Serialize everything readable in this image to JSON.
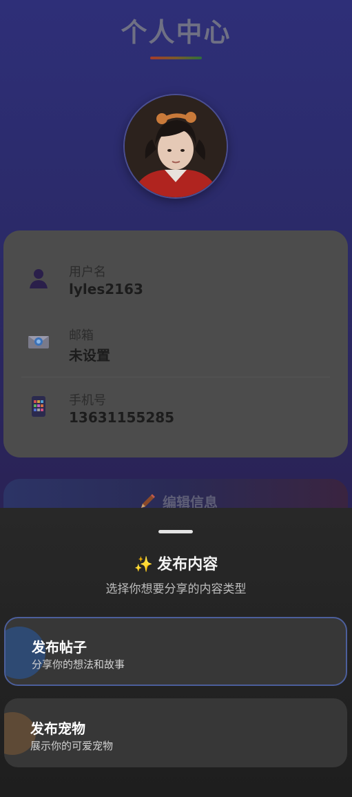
{
  "page": {
    "title": "个人中心",
    "colors": {
      "background": "#2b2a68",
      "card": "#4c4c4c",
      "accent_underline": [
        "#a63c2a",
        "#2f6f3a"
      ]
    }
  },
  "profile": {
    "avatar": "avatar-photo",
    "fields": [
      {
        "icon": "user-icon",
        "label": "用户名",
        "value": "lyles2163"
      },
      {
        "icon": "mail-icon",
        "label": "邮箱",
        "value": "未设置"
      },
      {
        "icon": "phone-icon",
        "label": "手机号",
        "value": "13631155285"
      }
    ],
    "edit_button": {
      "icon": "pencil-icon",
      "label": "编辑信息"
    }
  },
  "sheet": {
    "title_icon": "✨",
    "title": "发布内容",
    "subtitle": "选择你想要分享的内容类型",
    "options": [
      {
        "title": "发布帖子",
        "description": "分享你的想法和故事",
        "accent": "#2e4a73"
      },
      {
        "title": "发布宠物",
        "description": "展示你的可爱宠物",
        "accent": "#5e4a36"
      }
    ]
  }
}
